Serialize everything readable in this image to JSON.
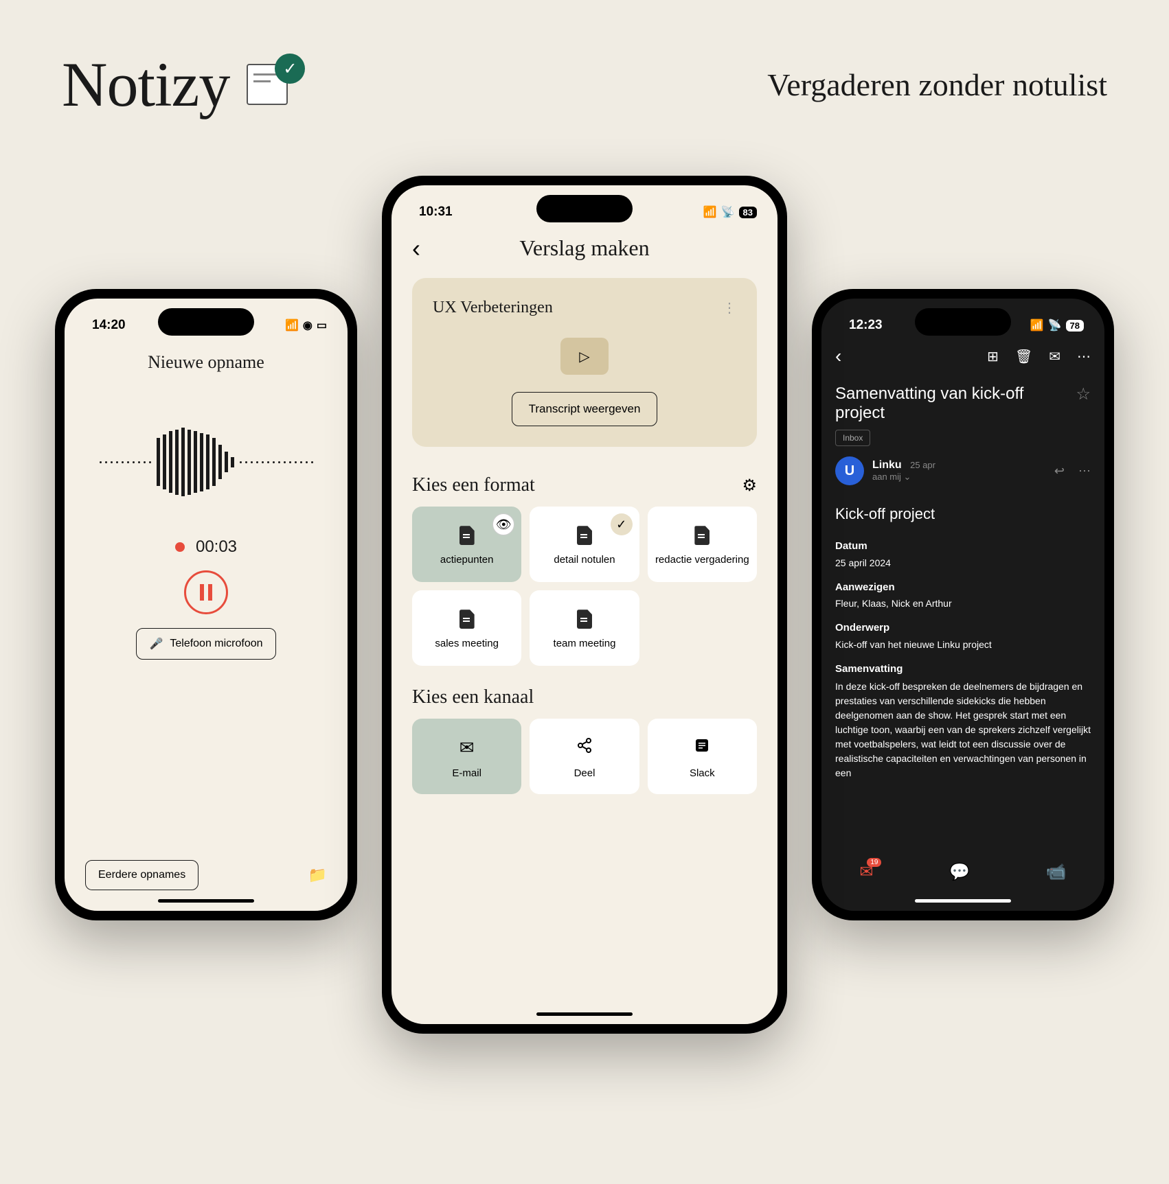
{
  "brand": "Notizy",
  "tagline": "Vergaderen zonder notulist",
  "phone_left": {
    "time": "14:20",
    "title": "Nieuwe opname",
    "rec_time": "00:03",
    "mic_label": "Telefoon microfoon",
    "recordings_label": "Eerdere opnames"
  },
  "phone_center": {
    "time": "10:31",
    "battery": "83",
    "screen_title": "Verslag maken",
    "recording_title": "UX Verbeteringen",
    "transcript_label": "Transcript weergeven",
    "format_section": "Kies een format",
    "formats": [
      {
        "label": "actiepunten",
        "selected": true,
        "badge": "eye"
      },
      {
        "label": "detail notulen",
        "badge": "check"
      },
      {
        "label": "redactie vergadering"
      },
      {
        "label": "sales meeting"
      },
      {
        "label": "team meeting"
      }
    ],
    "channel_section": "Kies een kanaal",
    "channels": [
      {
        "label": "E-mail",
        "icon": "mail",
        "selected": true
      },
      {
        "label": "Deel",
        "icon": "share"
      },
      {
        "label": "Slack",
        "icon": "slack"
      }
    ]
  },
  "phone_right": {
    "time": "12:23",
    "battery": "78",
    "subject": "Samenvatting van kick-off project",
    "inbox_label": "Inbox",
    "sender_name": "Linku",
    "sender_date": "25 apr",
    "sender_to": "aan mij",
    "avatar_letter": "U",
    "email_title": "Kick-off project",
    "date_label": "Datum",
    "date_value": "25 april 2024",
    "attendees_label": "Aanwezigen",
    "attendees_value": "Fleur, Klaas, Nick en Arthur",
    "topic_label": "Onderwerp",
    "topic_value": "Kick-off van het nieuwe Linku project",
    "summary_label": "Samenvatting",
    "summary_text": "In deze kick-off bespreken de deelnemers de bijdragen en prestaties van verschillende sidekicks die hebben deelgenomen aan de show. Het gesprek start met een luchtige toon, waarbij een van de sprekers zichzelf vergelijkt met voetbalspelers, wat leidt tot een discussie over de realistische capaciteiten en verwachtingen van personen in een",
    "nav_badge": "19"
  }
}
